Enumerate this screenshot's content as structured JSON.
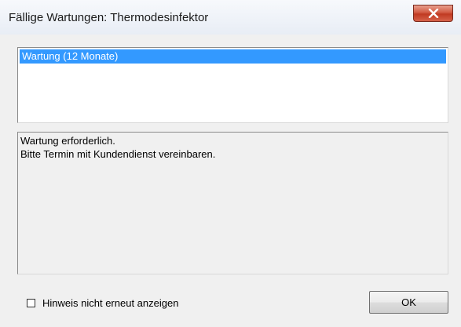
{
  "window": {
    "title": "Fällige Wartungen: Thermodesinfektor",
    "close_icon": "close-x-icon"
  },
  "maintenance_list": {
    "items": [
      {
        "label": "Wartung (12 Monate)",
        "selected": true
      }
    ]
  },
  "message": {
    "lines": [
      "Wartung erforderlich.",
      "Bitte Termin mit Kundendienst vereinbaren."
    ]
  },
  "dont_show_again": {
    "label": "Hinweis nicht erneut anzeigen",
    "checked": false
  },
  "ok_button": {
    "label": "OK"
  },
  "colors": {
    "selection": "#3399ff",
    "close_button": "#c7442b",
    "dialog_background": "#f0f0f0"
  }
}
